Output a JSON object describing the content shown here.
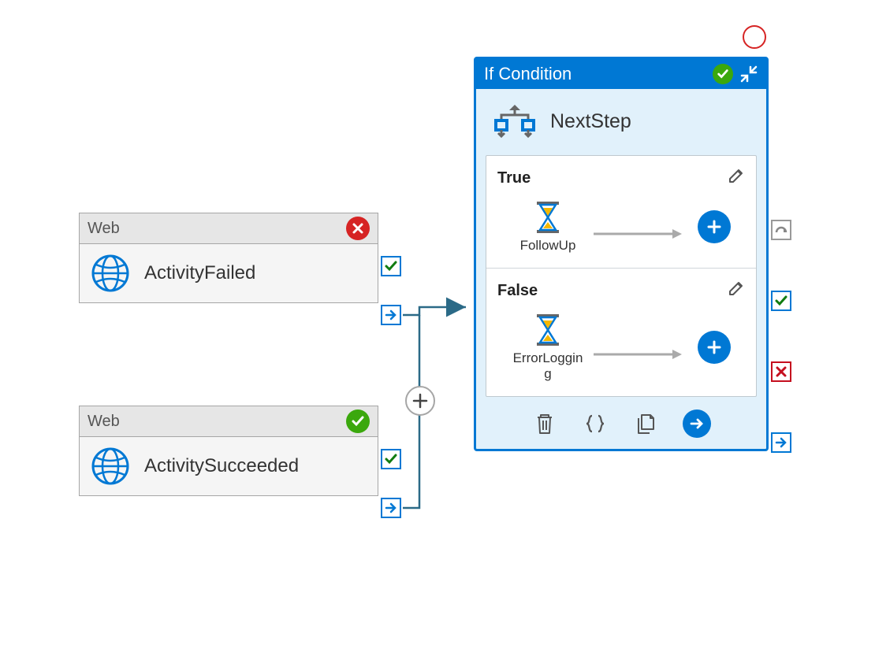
{
  "activities": {
    "failed": {
      "type_label": "Web",
      "name": "ActivityFailed",
      "status": "error"
    },
    "succeeded": {
      "type_label": "Web",
      "name": "ActivitySucceeded",
      "status": "success"
    }
  },
  "condition": {
    "header": "If Condition",
    "name": "NextStep",
    "branches": {
      "true": {
        "label": "True",
        "activity_name": "FollowUp"
      },
      "false": {
        "label": "False",
        "activity_name": "ErrorLogging"
      }
    }
  }
}
